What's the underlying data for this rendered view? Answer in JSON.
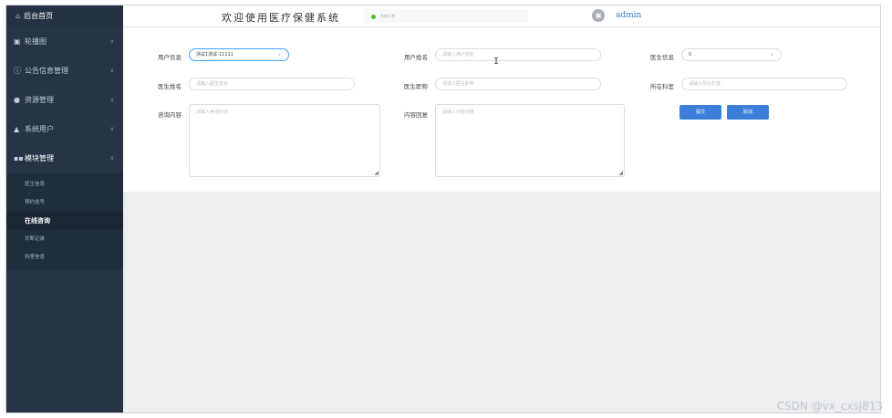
{
  "sidebar": {
    "brand": "后台首页",
    "menus": [
      {
        "icon": "image-icon",
        "glyph": "▣",
        "label": "轮播图"
      },
      {
        "icon": "info-icon",
        "glyph": "ⓘ",
        "label": "公告信息管理"
      },
      {
        "icon": "location-icon",
        "glyph": "●",
        "label": "资源管理"
      },
      {
        "icon": "user-icon",
        "glyph": "▲",
        "label": "系统用户"
      },
      {
        "icon": "grid-icon",
        "glyph": "▪▪",
        "label": "模块管理"
      }
    ],
    "submenu": [
      "医生信息",
      "预约挂号",
      "在线咨询",
      "诊断记录",
      "科室信息"
    ]
  },
  "topbar": {
    "title": "欢迎使用医疗保健系统",
    "status_text": "系统正常",
    "username": "admin"
  },
  "form": {
    "user_info_label": "用户信息",
    "user_info_value": "测试1测试-11111",
    "username_label": "用户姓名",
    "username_placeholder": "请输入用户姓名",
    "doctor_info_label": "医生信息",
    "doctor_info_value": "0",
    "doctor_name_label": "医生姓名",
    "doctor_name_placeholder": "请输入医生姓名",
    "doctor_title_label": "医生职称",
    "doctor_title_placeholder": "请输入医生职称",
    "dept_label": "所在科室",
    "dept_placeholder": "请输入所在科室",
    "consult_label": "咨询内容",
    "consult_placeholder": "请输入咨询内容",
    "reply_label": "内容回复",
    "reply_placeholder": "请输入内容回复",
    "submit_label": "提交",
    "cancel_label": "取消"
  },
  "watermark": "CSDN @vx_cxsj813"
}
